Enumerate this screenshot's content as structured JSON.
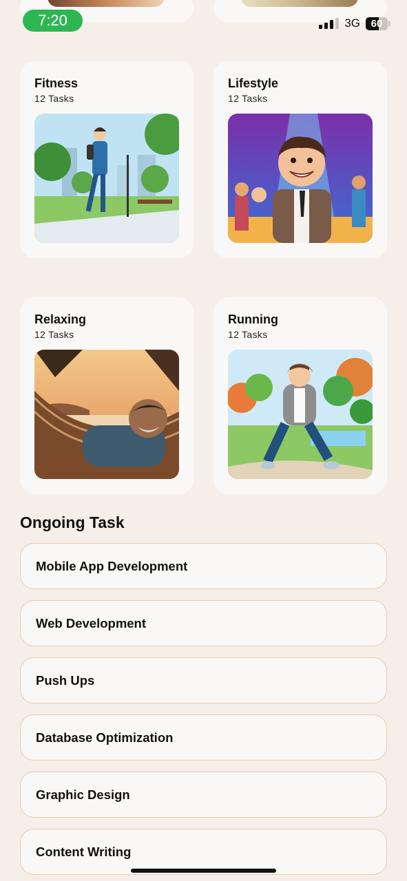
{
  "status_bar": {
    "time": "7:20",
    "network": "3G",
    "battery": "60"
  },
  "categories": [
    {
      "title": "Fitness",
      "subtitle": "12 Tasks",
      "image": "man-walking-in-park-illustration"
    },
    {
      "title": "Lifestyle",
      "subtitle": "12 Tasks",
      "image": "man-at-dance-party-illustration"
    },
    {
      "title": "Relaxing",
      "subtitle": "12 Tasks",
      "image": "man-sleeping-in-hammock-photo"
    },
    {
      "title": "Running",
      "subtitle": "12 Tasks",
      "image": "boy-running-in-park-illustration"
    }
  ],
  "ongoing": {
    "title": "Ongoing Task",
    "tasks": [
      "Mobile App Development",
      "Web Development",
      "Push Ups",
      "Database Optimization",
      "Graphic Design",
      "Content Writing"
    ]
  },
  "colors": {
    "background": "#f6efe9",
    "card": "#faf8f6",
    "task_border": "#edc9a8",
    "time_pill": "#2eb653"
  }
}
